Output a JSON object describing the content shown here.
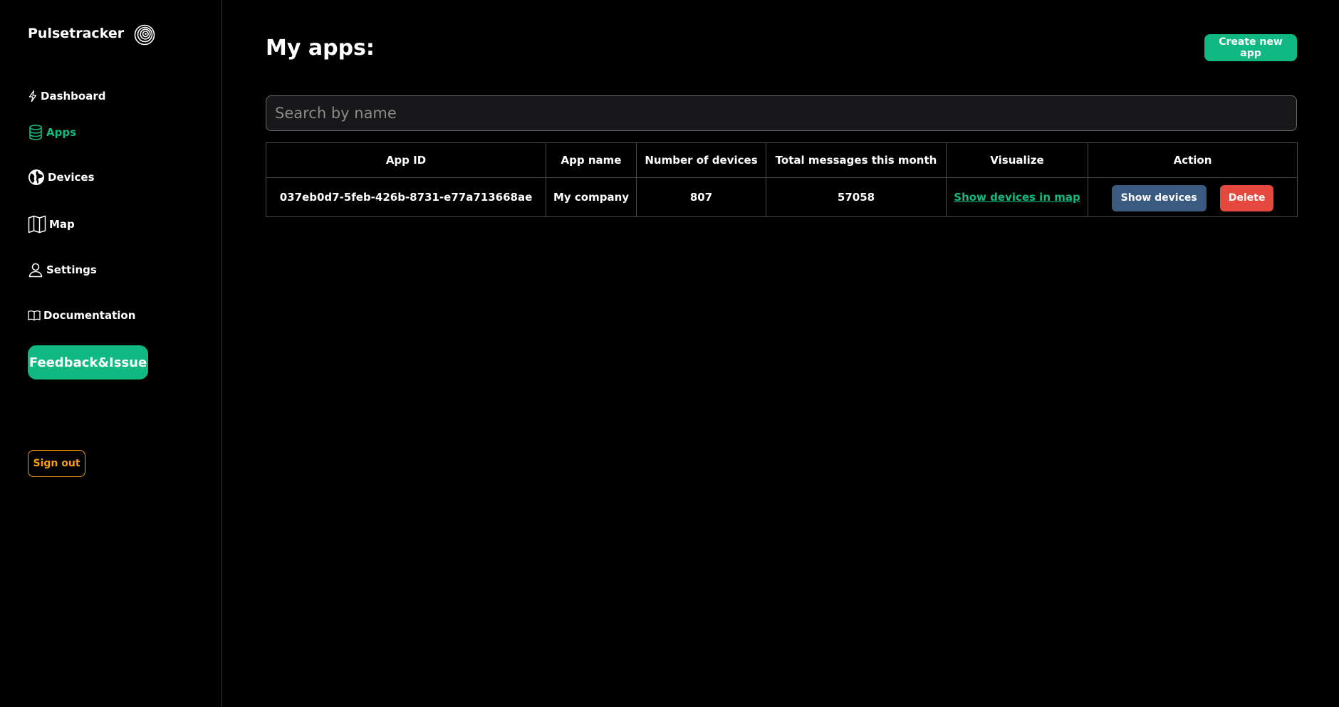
{
  "brand": {
    "name": "Pulsetracker",
    "logo_icon": "spiral-logo-icon"
  },
  "sidebar": {
    "items": [
      {
        "label": "Dashboard",
        "icon": "lightning-icon",
        "active": false
      },
      {
        "label": "Apps",
        "icon": "database-icon",
        "active": true
      },
      {
        "label": "Devices",
        "icon": "globe-icon",
        "active": false
      },
      {
        "label": "Map",
        "icon": "map-icon",
        "active": false
      },
      {
        "label": "Settings",
        "icon": "user-icon",
        "active": false
      },
      {
        "label": "Documentation",
        "icon": "book-icon",
        "active": false
      }
    ],
    "feedback_label": "Feedback&Issue",
    "signout_label": "Sign out"
  },
  "main": {
    "title": "My apps:",
    "create_label": "Create new app",
    "search": {
      "placeholder": "Search by name",
      "value": ""
    },
    "table": {
      "headers": [
        "App ID",
        "App name",
        "Number of devices",
        "Total messages this month",
        "Visualize",
        "Action"
      ],
      "rows": [
        {
          "app_id": "037eb0d7-5feb-426b-8731-e77a713668ae",
          "app_name": "My company",
          "devices": "807",
          "messages": "57058",
          "visualize_label": "Show devices in map",
          "show_devices_label": "Show devices",
          "delete_label": "Delete"
        }
      ]
    }
  },
  "colors": {
    "accent": "#10b981",
    "warning": "#f59e0b",
    "danger": "#e5483d",
    "secondary": "#3b5a80",
    "background": "#000000"
  }
}
